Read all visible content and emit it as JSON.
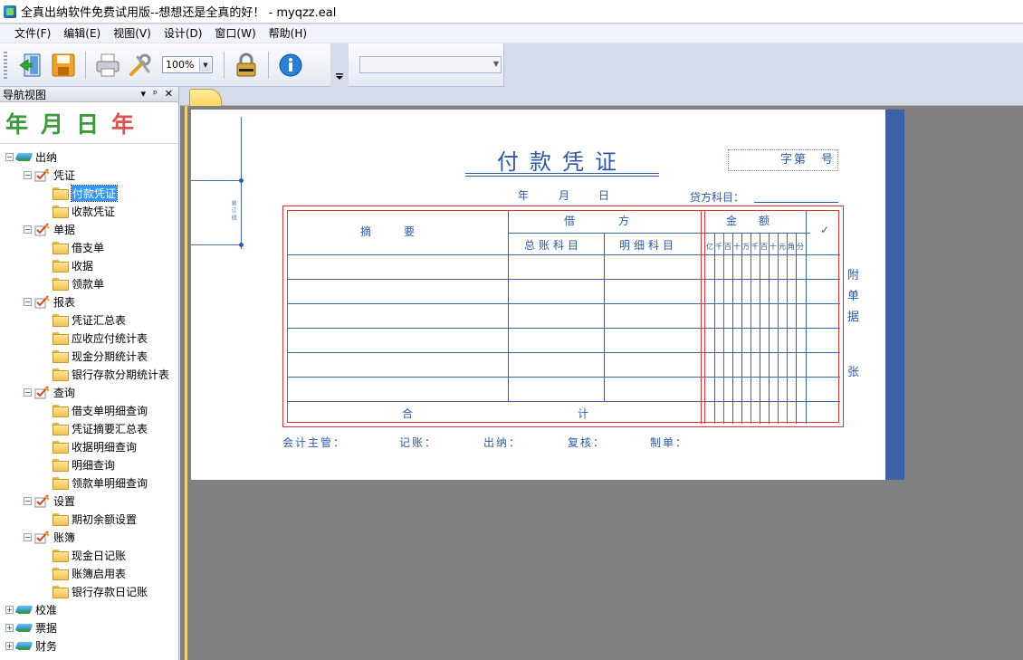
{
  "window": {
    "title": "全真出纳软件免费试用版--想想还是全真的好！ - myqzz.eal"
  },
  "menu": [
    "文件(F)",
    "编辑(E)",
    "视图(V)",
    "设计(D)",
    "窗口(W)",
    "帮助(H)"
  ],
  "toolbar": {
    "zoom": "100%",
    "icons": [
      "exit-icon",
      "save-icon",
      "print-icon",
      "settings-tools-icon",
      "lock-icon",
      "info-icon"
    ]
  },
  "nav": {
    "title": "导航视图",
    "controls": [
      "▾",
      "ᵖ",
      "✕"
    ],
    "date_glyphs": [
      {
        "text": "年",
        "color": "#3a9a3a"
      },
      {
        "text": "月",
        "color": "#3a9a3a"
      },
      {
        "text": "日",
        "color": "#3a9a3a"
      },
      {
        "text": "年",
        "color": "#e05050"
      }
    ],
    "tree": [
      {
        "level": 0,
        "type": "book",
        "expander": "−",
        "label": "出纳"
      },
      {
        "level": 1,
        "type": "check",
        "expander": "−",
        "label": "凭证"
      },
      {
        "level": 2,
        "type": "folder",
        "label": "付款凭证",
        "selected": true
      },
      {
        "level": 2,
        "type": "folder",
        "label": "收款凭证"
      },
      {
        "level": 1,
        "type": "check",
        "expander": "−",
        "label": "单据"
      },
      {
        "level": 2,
        "type": "folder",
        "label": "借支单"
      },
      {
        "level": 2,
        "type": "folder",
        "label": "收据"
      },
      {
        "level": 2,
        "type": "folder",
        "label": "领款单"
      },
      {
        "level": 1,
        "type": "check",
        "expander": "−",
        "label": "报表"
      },
      {
        "level": 2,
        "type": "folder",
        "label": "凭证汇总表"
      },
      {
        "level": 2,
        "type": "folder",
        "label": "应收应付统计表"
      },
      {
        "level": 2,
        "type": "folder",
        "label": "现金分期统计表"
      },
      {
        "level": 2,
        "type": "folder",
        "label": "银行存款分期统计表"
      },
      {
        "level": 1,
        "type": "check",
        "expander": "−",
        "label": "查询"
      },
      {
        "level": 2,
        "type": "folder",
        "label": "借支单明细查询"
      },
      {
        "level": 2,
        "type": "folder",
        "label": "凭证摘要汇总表"
      },
      {
        "level": 2,
        "type": "folder",
        "label": "收据明细查询"
      },
      {
        "level": 2,
        "type": "folder",
        "label": "明细查询"
      },
      {
        "level": 2,
        "type": "folder",
        "label": "领款单明细查询"
      },
      {
        "level": 1,
        "type": "check",
        "expander": "−",
        "label": "设置"
      },
      {
        "level": 2,
        "type": "folder",
        "label": "期初余额设置"
      },
      {
        "level": 1,
        "type": "check",
        "expander": "−",
        "label": "账簿"
      },
      {
        "level": 2,
        "type": "folder",
        "label": "现金日记账"
      },
      {
        "level": 2,
        "type": "folder",
        "label": "账簿启用表"
      },
      {
        "level": 2,
        "type": "folder",
        "label": "银行存款日记账"
      },
      {
        "level": 0,
        "type": "book",
        "expander": "+",
        "label": "校准"
      },
      {
        "level": 0,
        "type": "book",
        "expander": "+",
        "label": "票据"
      },
      {
        "level": 0,
        "type": "book",
        "expander": "+",
        "label": "财务"
      }
    ]
  },
  "voucher": {
    "title": "付款凭证",
    "number_label": "字第　号",
    "year": "年",
    "month": "月",
    "day": "日",
    "credit_account": "贷方科目：",
    "binding_text": "装订线",
    "col_summary": "摘　　　要",
    "col_debit": "借　　　　方",
    "col_general": "总账科目",
    "col_detail": "明细科目",
    "col_amount": "金　　额",
    "col_check": "✓",
    "digits": [
      "亿",
      "千",
      "百",
      "十",
      "万",
      "千",
      "百",
      "十",
      "元",
      "角",
      "分"
    ],
    "total_left": "合",
    "total_right": "计",
    "footer": {
      "supervisor": "会计主管：",
      "bookkeeper": "记账：",
      "cashier": "出纳：",
      "reviewer": "复核：",
      "maker": "制单："
    },
    "attachment": [
      "附",
      "单",
      "据",
      "张"
    ]
  }
}
